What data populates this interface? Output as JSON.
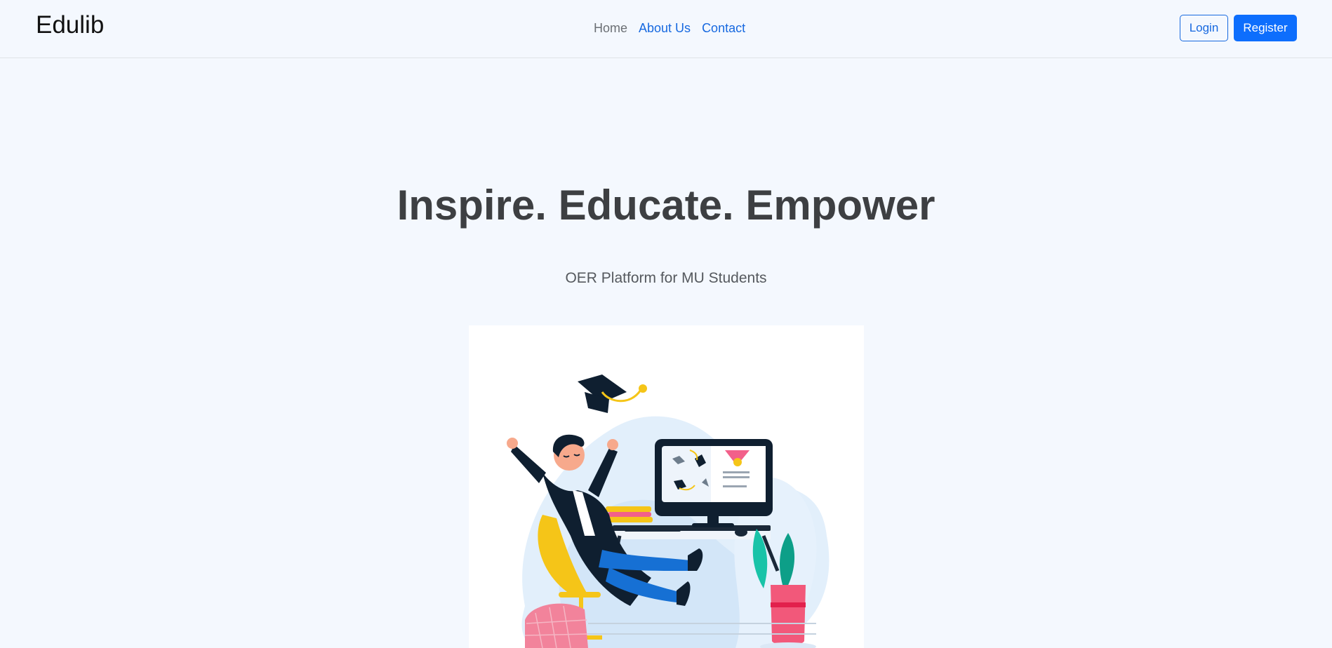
{
  "navbar": {
    "brand": "Edulib",
    "links": [
      {
        "label": "Home",
        "active": true
      },
      {
        "label": "About Us",
        "active": false
      },
      {
        "label": "Contact",
        "active": false
      }
    ],
    "login_label": "Login",
    "register_label": "Register"
  },
  "hero": {
    "title": "Inspire. Educate. Empower",
    "subtitle": "OER Platform for MU Students",
    "illustration": "graduate-celebrating-at-computer-illustration"
  },
  "colors": {
    "background": "#f4f8fe",
    "primary": "#0d6efd",
    "link": "#1769e0",
    "title": "#3d3f42"
  }
}
